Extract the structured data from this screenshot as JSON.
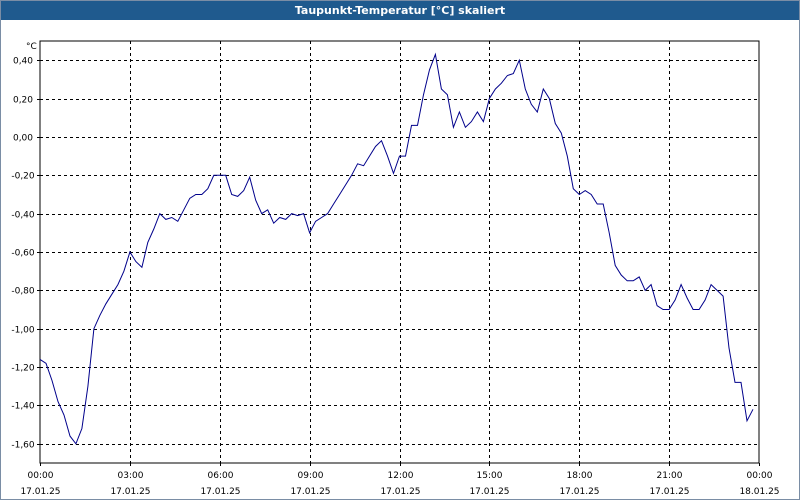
{
  "window": {
    "title": "Taupunkt-Temperatur [°C] skaliert"
  },
  "chart_data": {
    "type": "line",
    "title": "Taupunkt-Temperatur [°C] skaliert",
    "ylabel": "°C",
    "xlabel": "",
    "ylim": [
      -1.7,
      0.5
    ],
    "xlim": [
      0,
      24
    ],
    "grid": true,
    "line_color": "#00008b",
    "y_ticks": [
      {
        "value": 0.4,
        "label": "0,40"
      },
      {
        "value": 0.2,
        "label": "0,20"
      },
      {
        "value": 0.0,
        "label": "0,00"
      },
      {
        "value": -0.2,
        "label": "-0,20"
      },
      {
        "value": -0.4,
        "label": "-0,40"
      },
      {
        "value": -0.6,
        "label": "-0,60"
      },
      {
        "value": -0.8,
        "label": "-0,80"
      },
      {
        "value": -1.0,
        "label": "-1,00"
      },
      {
        "value": -1.2,
        "label": "-1,20"
      },
      {
        "value": -1.4,
        "label": "-1,40"
      },
      {
        "value": -1.6,
        "label": "-1,60"
      }
    ],
    "x_ticks": [
      {
        "value": 0,
        "time": "00:00",
        "date": "17.01.25"
      },
      {
        "value": 3,
        "time": "03:00",
        "date": "17.01.25"
      },
      {
        "value": 6,
        "time": "06:00",
        "date": "17.01.25"
      },
      {
        "value": 9,
        "time": "09:00",
        "date": "17.01.25"
      },
      {
        "value": 12,
        "time": "12:00",
        "date": "17.01.25"
      },
      {
        "value": 15,
        "time": "15:00",
        "date": "17.01.25"
      },
      {
        "value": 18,
        "time": "18:00",
        "date": "17.01.25"
      },
      {
        "value": 21,
        "time": "21:00",
        "date": "17.01.25"
      },
      {
        "value": 24,
        "time": "00:00",
        "date": "18.01.25"
      }
    ],
    "series": [
      {
        "x": [
          0,
          0.2,
          0.4,
          0.6,
          0.8,
          1.0,
          1.2,
          1.4,
          1.6,
          1.8,
          2.0,
          2.2,
          2.4,
          2.6,
          2.8,
          3.0,
          3.2,
          3.4,
          3.6,
          3.8,
          4.0,
          4.2,
          4.4,
          4.6,
          4.8,
          5.0,
          5.2,
          5.4,
          5.6,
          5.8,
          6.0,
          6.2,
          6.4,
          6.6,
          6.8,
          7.0,
          7.2,
          7.4,
          7.6,
          7.8,
          8.0,
          8.2,
          8.4,
          8.6,
          8.8,
          9.0,
          9.2,
          9.4,
          9.6,
          9.8,
          10.0,
          10.2,
          10.4,
          10.6,
          10.8,
          11.0,
          11.2,
          11.4,
          11.6,
          11.8,
          12.0,
          12.2,
          12.4,
          12.6,
          12.8,
          13.0,
          13.2,
          13.4,
          13.6,
          13.8,
          14.0,
          14.2,
          14.4,
          14.6,
          14.8,
          15.0,
          15.2,
          15.4,
          15.6,
          15.8,
          16.0,
          16.2,
          16.4,
          16.6,
          16.8,
          17.0,
          17.2,
          17.4,
          17.6,
          17.8,
          18.0,
          18.2,
          18.4,
          18.6,
          18.8,
          19.0,
          19.2,
          19.4,
          19.6,
          19.8,
          20.0,
          20.2,
          20.4,
          20.6,
          20.8,
          21.0,
          21.2,
          21.4,
          21.6,
          21.8,
          22.0,
          22.2,
          22.4,
          22.6,
          22.8,
          23.0,
          23.2,
          23.4,
          23.6,
          23.8
        ],
        "values": [
          -1.16,
          -1.18,
          -1.27,
          -1.38,
          -1.45,
          -1.56,
          -1.6,
          -1.52,
          -1.3,
          -1.0,
          -0.93,
          -0.87,
          -0.82,
          -0.77,
          -0.7,
          -0.6,
          -0.65,
          -0.68,
          -0.55,
          -0.48,
          -0.4,
          -0.43,
          -0.42,
          -0.44,
          -0.38,
          -0.32,
          -0.3,
          -0.3,
          -0.27,
          -0.2,
          -0.2,
          -0.2,
          -0.3,
          -0.31,
          -0.28,
          -0.21,
          -0.33,
          -0.4,
          -0.38,
          -0.45,
          -0.42,
          -0.43,
          -0.4,
          -0.41,
          -0.4,
          -0.5,
          -0.44,
          -0.42,
          -0.4,
          -0.35,
          -0.3,
          -0.25,
          -0.2,
          -0.14,
          -0.15,
          -0.1,
          -0.05,
          -0.02,
          -0.1,
          -0.19,
          -0.1,
          -0.1,
          0.06,
          0.06,
          0.22,
          0.35,
          0.43,
          0.25,
          0.22,
          0.05,
          0.13,
          0.05,
          0.08,
          0.13,
          0.08,
          0.2,
          0.25,
          0.28,
          0.32,
          0.33,
          0.4,
          0.25,
          0.17,
          0.13,
          0.25,
          0.2,
          0.07,
          0.02,
          -0.1,
          -0.27,
          -0.3,
          -0.28,
          -0.3,
          -0.35,
          -0.35,
          -0.5,
          -0.67,
          -0.72,
          -0.75,
          -0.75,
          -0.73,
          -0.8,
          -0.77,
          -0.88,
          -0.9,
          -0.9,
          -0.85,
          -0.77,
          -0.84,
          -0.9,
          -0.9,
          -0.85,
          -0.77,
          -0.8,
          -0.83,
          -1.1,
          -1.28,
          -1.28,
          -1.48,
          -1.42
        ]
      }
    ]
  }
}
